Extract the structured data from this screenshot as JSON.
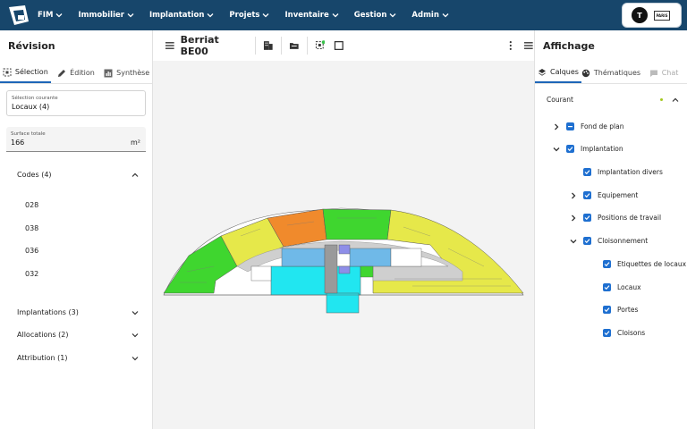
{
  "nav": {
    "items": [
      "FIM",
      "Immobilier",
      "Implantation",
      "Projets",
      "Inventaire",
      "Gestion",
      "Admin"
    ]
  },
  "user": {
    "initial": "T",
    "brand": "PARIS"
  },
  "left": {
    "title": "Révision",
    "tabs": [
      "Sélection",
      "Édition",
      "Synthèse"
    ],
    "selection": {
      "label": "Sélection courante",
      "value": "Locaux (4)"
    },
    "surface": {
      "label": "Surface totale",
      "value": "166",
      "unit": "m²"
    },
    "codes": {
      "title": "Codes (4)",
      "items": [
        "028",
        "038",
        "036",
        "032"
      ]
    },
    "sections": [
      "Implantations (3)",
      "Allocations (2)",
      "Attribution (1)"
    ]
  },
  "center": {
    "title": "Berriat BE00"
  },
  "right": {
    "title": "Affichage",
    "tabs": [
      "Calques",
      "Thématiques",
      "Chat"
    ],
    "current": "Courant",
    "layers": [
      {
        "label": "Fond de plan",
        "state": "partial"
      },
      {
        "label": "Implantation",
        "state": "checked"
      },
      {
        "label": "Implantation divers",
        "state": "checked"
      },
      {
        "label": "Equipement",
        "state": "checked"
      },
      {
        "label": "Positions de travail",
        "state": "checked"
      },
      {
        "label": "Cloisonnement",
        "state": "checked"
      },
      {
        "label": "Etiquettes de locaux",
        "state": "checked"
      },
      {
        "label": "Locaux",
        "state": "checked"
      },
      {
        "label": "Portes",
        "state": "checked"
      },
      {
        "label": "Cloisons",
        "state": "checked"
      }
    ]
  },
  "colors": {
    "topbar": "#17466b",
    "accent": "#1e6fd0",
    "green": "#3fd62f",
    "yellow": "#e6e84a",
    "orange": "#f08a2c",
    "cyan": "#21e6f0"
  }
}
